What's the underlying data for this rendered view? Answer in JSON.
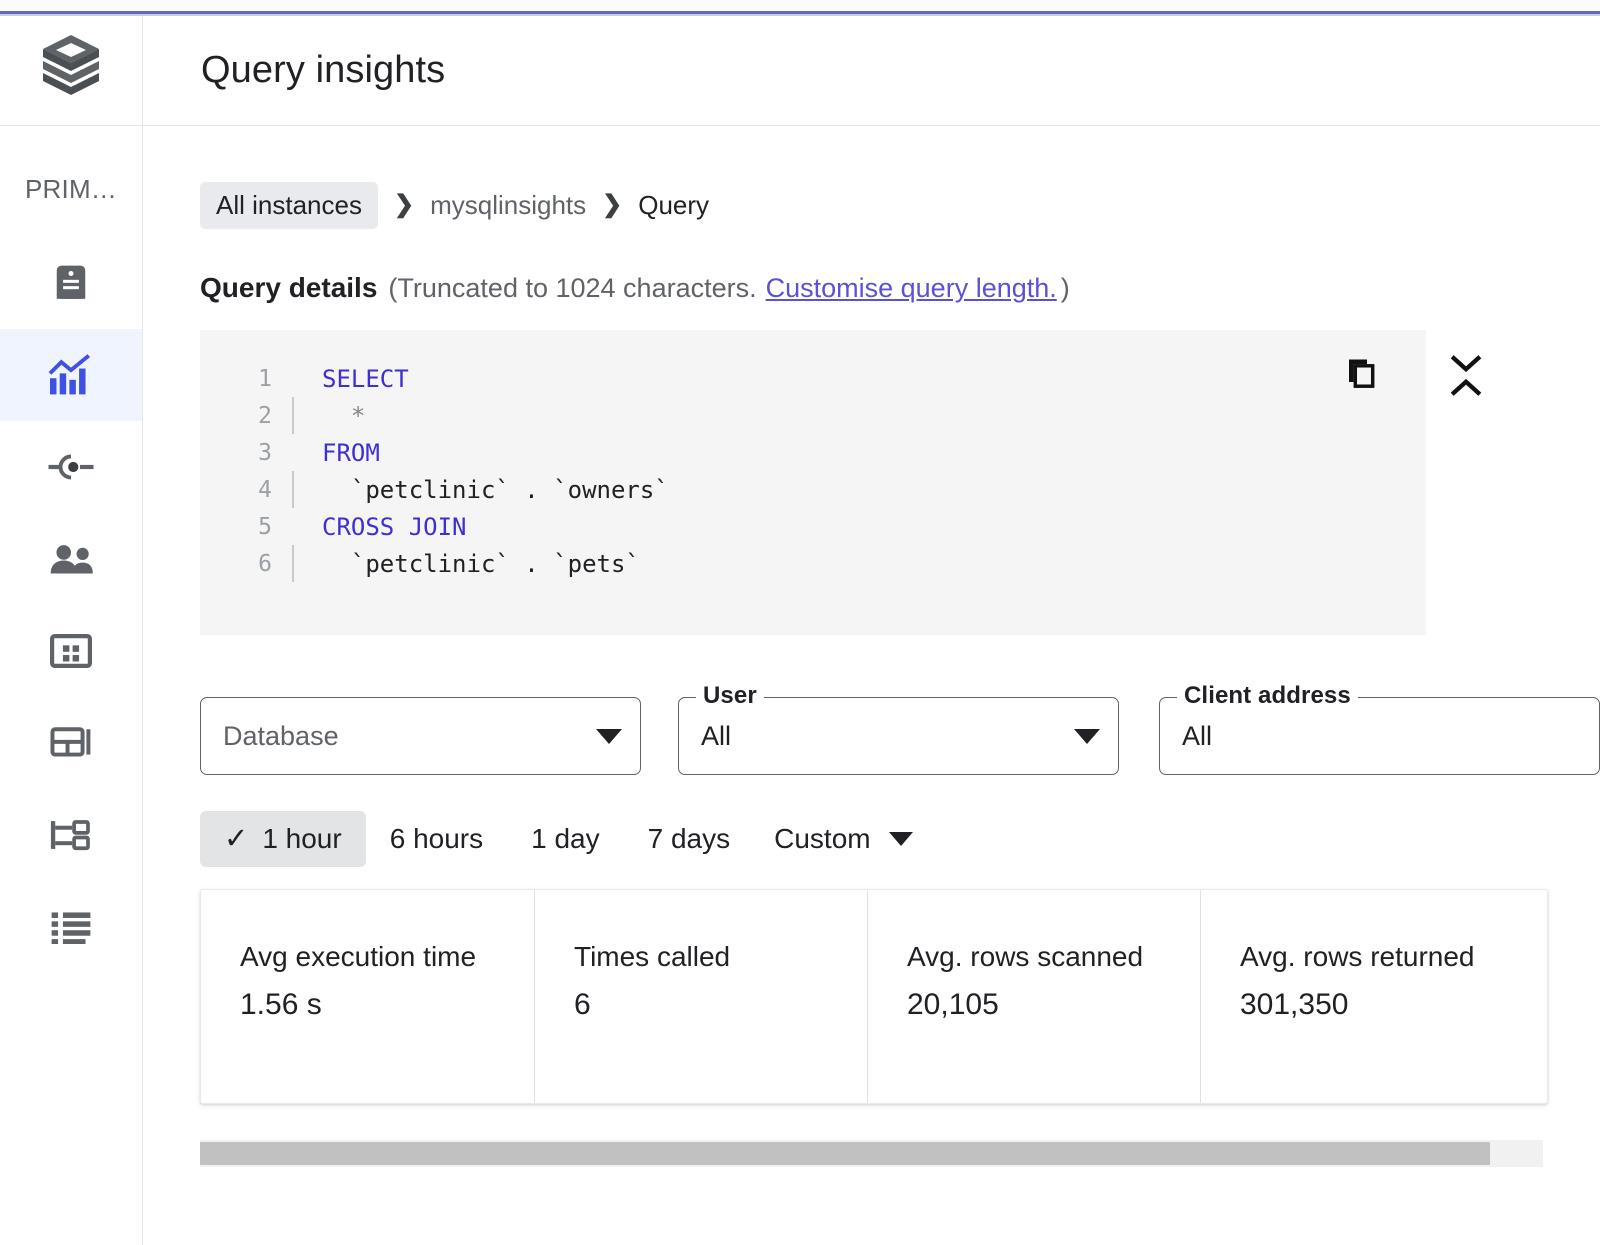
{
  "brand": {
    "logo_icon": "cloud-sql-stack-logo",
    "accent_color": "#5c6bc0"
  },
  "header": {
    "title": "Query insights"
  },
  "sidebar": {
    "section_label": "PRIM…",
    "items": [
      {
        "icon": "overview-database-icon",
        "name": "overview",
        "active": false
      },
      {
        "icon": "query-insights-chart-icon",
        "name": "query-insights",
        "active": true
      },
      {
        "icon": "connections-icon",
        "name": "connections",
        "active": false
      },
      {
        "icon": "users-icon",
        "name": "users",
        "active": false
      },
      {
        "icon": "databases-grid-icon",
        "name": "databases",
        "active": false
      },
      {
        "icon": "backups-icon",
        "name": "backups",
        "active": false
      },
      {
        "icon": "replicas-branch-icon",
        "name": "replicas",
        "active": false
      },
      {
        "icon": "operations-list-icon",
        "name": "operations",
        "active": false
      }
    ]
  },
  "breadcrumb": {
    "items": [
      {
        "label": "All instances",
        "style": "chip"
      },
      {
        "label": "mysqlinsights",
        "style": "link"
      },
      {
        "label": "Query",
        "style": "current"
      }
    ],
    "separator": "❯"
  },
  "query_details": {
    "title": "Query details",
    "note_prefix": "(Truncated to 1024 characters.",
    "link_label": "Customise query length.",
    "note_suffix": ")",
    "copy_icon": "copy-icon",
    "collapse_icon": "collapse-chevrons-icon",
    "code_lines": [
      {
        "num": "1",
        "guide": false,
        "tokens": [
          {
            "t": "SELECT",
            "k": "kw"
          }
        ]
      },
      {
        "num": "2",
        "guide": true,
        "tokens": [
          {
            "t": "  *",
            "k": "dim"
          }
        ]
      },
      {
        "num": "3",
        "guide": false,
        "tokens": [
          {
            "t": "FROM",
            "k": "kw"
          }
        ]
      },
      {
        "num": "4",
        "guide": true,
        "tokens": [
          {
            "t": "  `petclinic` . `owners`",
            "k": "plain"
          }
        ]
      },
      {
        "num": "5",
        "guide": false,
        "tokens": [
          {
            "t": "CROSS JOIN",
            "k": "kw"
          }
        ]
      },
      {
        "num": "6",
        "guide": true,
        "tokens": [
          {
            "t": "  `petclinic` . `pets`",
            "k": "plain"
          }
        ]
      }
    ]
  },
  "filters": {
    "database": {
      "legend": "",
      "value": "Database",
      "is_placeholder": true
    },
    "user": {
      "legend": "User",
      "value": "All",
      "is_placeholder": false
    },
    "client_address": {
      "legend": "Client address",
      "value": "All",
      "is_placeholder": false
    }
  },
  "time_range": {
    "selected": "1 hour",
    "check_glyph": "✓",
    "options": [
      "1 hour",
      "6 hours",
      "1 day",
      "7 days"
    ],
    "custom_label": "Custom"
  },
  "metrics": [
    {
      "label": "Avg execution time",
      "value": "1.56 s"
    },
    {
      "label": "Times called",
      "value": "6"
    },
    {
      "label": "Avg. rows scanned",
      "value": "20,105"
    },
    {
      "label": "Avg. rows returned",
      "value": "301,350"
    }
  ]
}
